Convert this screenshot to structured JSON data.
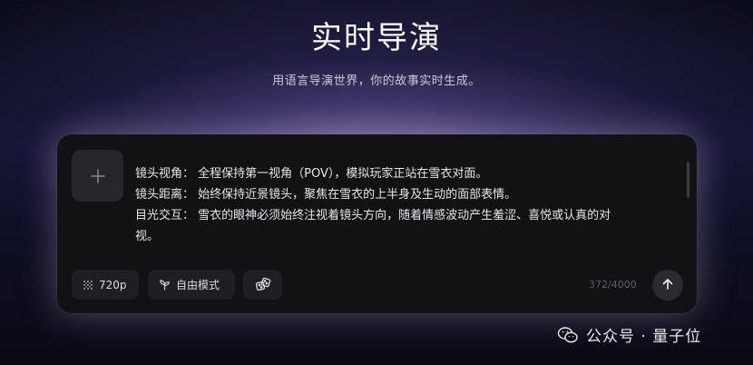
{
  "header": {
    "title": "实时导演",
    "subtitle": "用语言导演世界，你的故事实时生成。"
  },
  "composer": {
    "add_icon": "plus-icon",
    "prompt_lines": [
      "镜头视角：  全程保持第一视角（POV），模拟玩家正站在雪衣对面。",
      "镜头距离：  始终保持近景镜头，聚焦在雪衣的上半身及生动的面部表情。",
      "目光交互：  雪衣的眼神必须始终注视着镜头方向，随着情感波动产生羞涩、喜悦或认真的对",
      "视。"
    ],
    "resolution_label": "720p",
    "resolution_icon": "dot-grid-icon",
    "mode_label": "自由模式",
    "mode_icon": "sprout-icon",
    "dice_icon": "dice-icon",
    "char_count": "372/4000",
    "send_icon": "arrow-up-icon"
  },
  "watermark": {
    "text": "公众号 · 量子位",
    "icon": "wechat-icon"
  },
  "colors": {
    "card_bg": "#121215",
    "glow": "#d2bee6",
    "pill_bg": "#1f1f23"
  }
}
